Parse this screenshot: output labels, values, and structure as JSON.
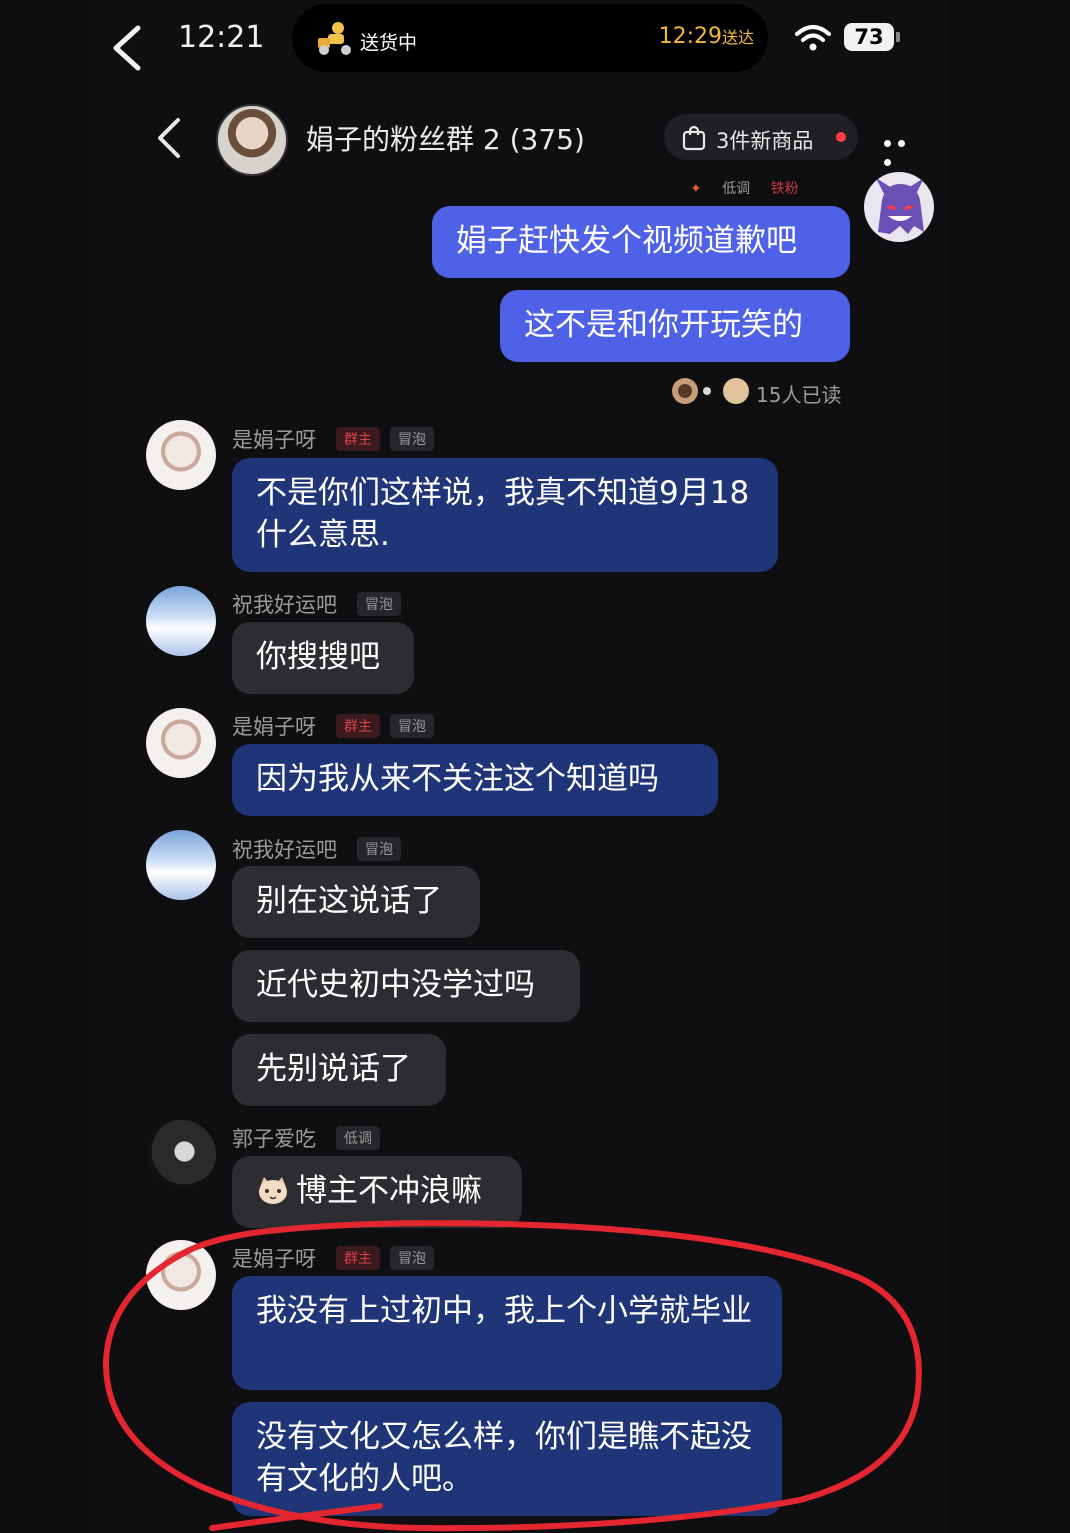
{
  "status_bar": {
    "time": "12:21",
    "delivery_status": "送货中",
    "eta_time": "12:29",
    "eta_suffix": "送达",
    "battery": "73"
  },
  "header": {
    "title": "娟子的粉丝群 2 (375)",
    "products_label": "3件新商品"
  },
  "own_tags": [
    "低调",
    "铁粉"
  ],
  "messages": [
    {
      "side": "right",
      "text": "娟子赶快发个视频道歉吧"
    },
    {
      "side": "right",
      "text": "这不是和你开玩笑的"
    },
    {
      "read_receipt": "15人已读"
    },
    {
      "sender": "是娟子呀",
      "badges": [
        "群主",
        "冒泡"
      ],
      "text": "不是你们这样说，我真不知道9月18什么意思."
    },
    {
      "sender": "祝我好运吧",
      "badges": [
        "冒泡"
      ],
      "text": "你搜搜吧"
    },
    {
      "sender": "是娟子呀",
      "badges": [
        "群主",
        "冒泡"
      ],
      "text": "因为我从来不关注这个知道吗"
    },
    {
      "sender": "祝我好运吧",
      "badges": [
        "冒泡"
      ],
      "texts": [
        "别在这说话了",
        "近代史初中没学过吗",
        "先别说话了"
      ]
    },
    {
      "sender": "郭子爱吃",
      "badges": [
        "低调"
      ],
      "text": "博主不冲浪嘛"
    },
    {
      "sender": "是娟子呀",
      "badges": [
        "群主",
        "冒泡"
      ],
      "texts": [
        "我没有上过初中，我上个小学就毕业",
        "没有文化又怎么样，你们是瞧不起没有文化的人吧。"
      ]
    }
  ],
  "colors": {
    "my_bubble": "#4f61e6",
    "owner_bubble": "#1f3577",
    "other_bubble": "#2d2d31",
    "annotation_circle": "#e3262f"
  }
}
